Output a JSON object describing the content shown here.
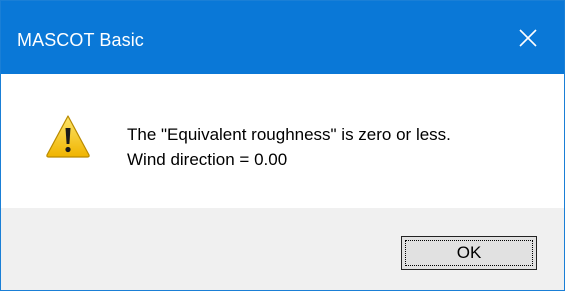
{
  "window": {
    "title": "MASCOT Basic",
    "close_icon": "close-icon"
  },
  "dialog": {
    "icon": "warning-icon",
    "message_line1": "The \"Equivalent roughness\" is zero or less.",
    "message_line2": "Wind direction = 0.00"
  },
  "footer": {
    "ok_label": "OK"
  },
  "colors": {
    "titlebar": "#0a78d7",
    "footer": "#f0f0f0",
    "button": "#e1e1e1",
    "warning_fill": "#f6c21c"
  }
}
